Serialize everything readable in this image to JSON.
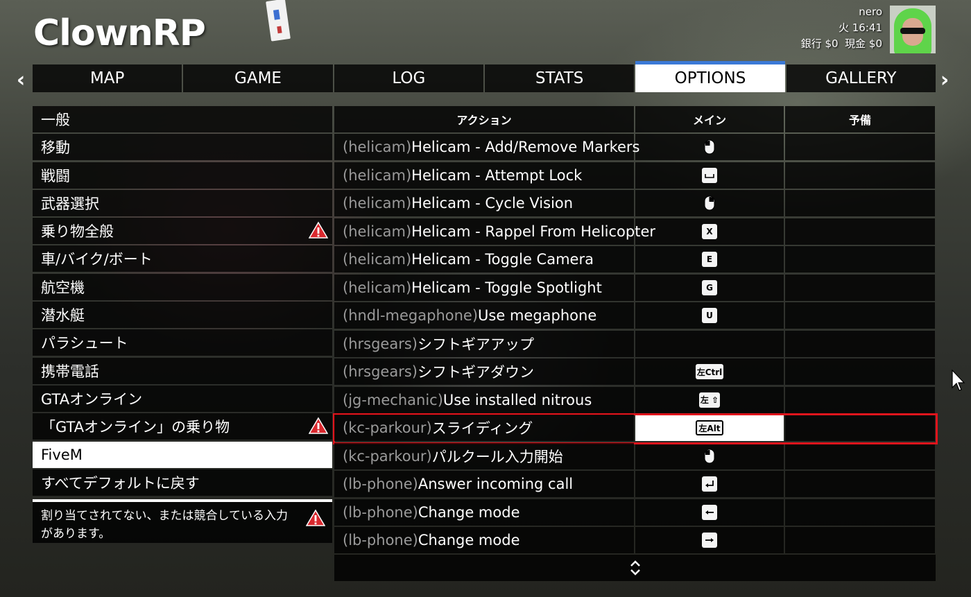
{
  "header": {
    "title": "ClownRP"
  },
  "player": {
    "name": "nero",
    "time": "火 16:41",
    "money": "銀行 $0  現金 $0"
  },
  "nav": {
    "prev_icon": "chevron-left-icon",
    "next_icon": "chevron-right-icon",
    "tabs": [
      {
        "label": "MAP"
      },
      {
        "label": "GAME"
      },
      {
        "label": "LOG"
      },
      {
        "label": "STATS"
      },
      {
        "label": "OPTIONS",
        "active": true
      },
      {
        "label": "GALLERY"
      }
    ],
    "accent_color": "#3b79d6"
  },
  "categories": [
    {
      "label": "一般"
    },
    {
      "label": "移動"
    },
    {
      "label": "戦闘"
    },
    {
      "label": "武器選択"
    },
    {
      "label": "乗り物全般",
      "warning": true
    },
    {
      "label": "車/バイク/ボート"
    },
    {
      "label": "航空機"
    },
    {
      "label": "潜水艇"
    },
    {
      "label": "パラシュート"
    },
    {
      "label": "携帯電話"
    },
    {
      "label": "GTAオンライン"
    },
    {
      "label": "「GTAオンライン」の乗り物",
      "warning": true
    },
    {
      "label": "FiveM",
      "active": true
    },
    {
      "label": "すべてデフォルトに戻す"
    }
  ],
  "warning_note": "割り当てされてない、または競合している入力があります。",
  "table": {
    "headers": {
      "action": "アクション",
      "main": "メイン",
      "alt": "予備"
    },
    "rows": [
      {
        "resource": "(helicam)",
        "action": "Helicam - Add/Remove Markers",
        "main_key": "mouse-left-icon",
        "alt_key": ""
      },
      {
        "resource": "(helicam)",
        "action": "Helicam - Attempt Lock",
        "main_key": "space-key-icon",
        "alt_key": ""
      },
      {
        "resource": "(helicam)",
        "action": "Helicam - Cycle Vision",
        "main_key": "mouse-right-icon",
        "alt_key": ""
      },
      {
        "resource": "(helicam)",
        "action": "Helicam - Rappel From Helicopter",
        "main_key": "X",
        "alt_key": ""
      },
      {
        "resource": "(helicam)",
        "action": "Helicam - Toggle Camera",
        "main_key": "E",
        "alt_key": ""
      },
      {
        "resource": "(helicam)",
        "action": "Helicam - Toggle Spotlight",
        "main_key": "G",
        "alt_key": ""
      },
      {
        "resource": "(hndl-megaphone)",
        "action": "Use megaphone",
        "main_key": "U",
        "alt_key": ""
      },
      {
        "resource": "(hrsgears)",
        "action": "シフトギアアップ",
        "main_key": "",
        "alt_key": ""
      },
      {
        "resource": "(hrsgears)",
        "action": "シフトギアダウン",
        "main_key": "左Ctrl",
        "alt_key": ""
      },
      {
        "resource": "(jg-mechanic)",
        "action": "Use installed nitrous",
        "main_key": "左 ⇧",
        "alt_key": ""
      },
      {
        "resource": "(kc-parkour)",
        "action": "スライディング",
        "main_key": "左Alt",
        "alt_key": "",
        "selected": true
      },
      {
        "resource": "(kc-parkour)",
        "action": "パルクール入力開始",
        "main_key": "mouse-left-icon",
        "alt_key": ""
      },
      {
        "resource": "(lb-phone)",
        "action": "Answer incoming call",
        "main_key": "enter-key-icon",
        "alt_key": ""
      },
      {
        "resource": "(lb-phone)",
        "action": "Change mode",
        "main_key": "arrow-left-key-icon",
        "alt_key": ""
      },
      {
        "resource": "(lb-phone)",
        "action": "Change mode",
        "main_key": "arrow-right-key-icon",
        "alt_key": ""
      }
    ],
    "selection_color": "#e0141c"
  },
  "scroll": {
    "icon": "scroll-updown-icon"
  }
}
